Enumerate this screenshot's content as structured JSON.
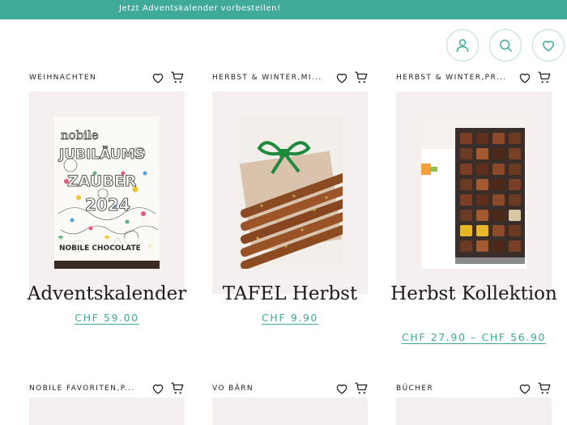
{
  "announcement": "Jetzt Adventskalender vorbestellen!",
  "header": {
    "icons": [
      "user-icon",
      "search-icon",
      "heart-icon"
    ]
  },
  "colors": {
    "accent": "#3fa99a",
    "tile_bg": "#f5efef"
  },
  "products": [
    {
      "category": "WEIHNACHTEN",
      "title": "Adventskalender",
      "price": "CHF 59.00"
    },
    {
      "category": "HERBST & WINTER,MI...",
      "title": "TAFEL Herbst",
      "price": "CHF 9.90"
    },
    {
      "category": "HERBST & WINTER,PR...",
      "title": "Herbst Kollektion",
      "price": "CHF 27.90 – CHF 56.90"
    }
  ],
  "products_row2": [
    {
      "category": "NOBILE FAVORITEN,P..."
    },
    {
      "category": "VO BÄRN"
    },
    {
      "category": "BÜCHER"
    }
  ],
  "calendar_art": {
    "brand": "nobile",
    "lines": [
      "JUBILÄUMS",
      "ZAUBER",
      "2024"
    ],
    "footer": "NOBILE CHOCOLATE"
  }
}
